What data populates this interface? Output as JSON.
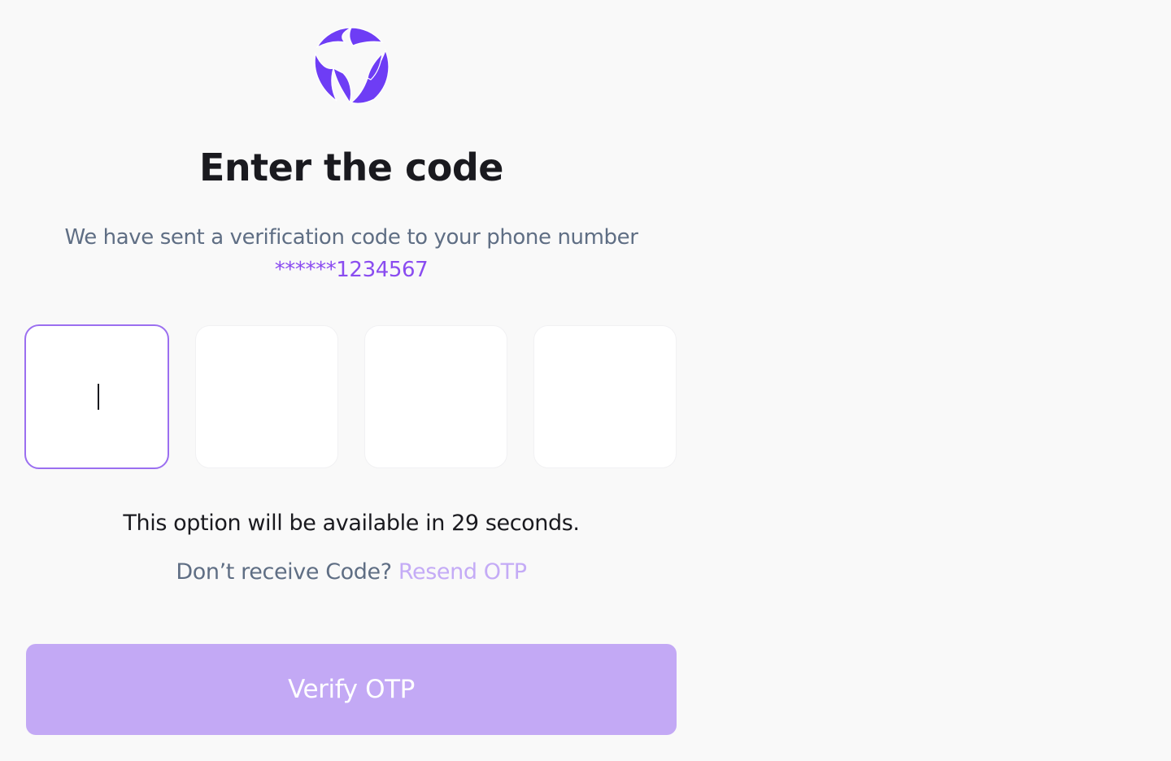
{
  "brand": {
    "accent": "#6e3df5",
    "accent_light": "#c3a9f5",
    "logo_icon": "three-leaf-ring-logo"
  },
  "header": {
    "title": "Enter the code"
  },
  "message": {
    "text": "We have sent a verification code to your phone number",
    "phone_masked": "******1234567"
  },
  "otp": {
    "digits": [
      "",
      "",
      "",
      ""
    ],
    "active_index": 0
  },
  "timer": {
    "text": "This option will be available in 29 seconds."
  },
  "resend": {
    "prompt": "Don’t receive Code? ",
    "link_label": "Resend OTP"
  },
  "actions": {
    "verify_label": "Verify OTP"
  }
}
